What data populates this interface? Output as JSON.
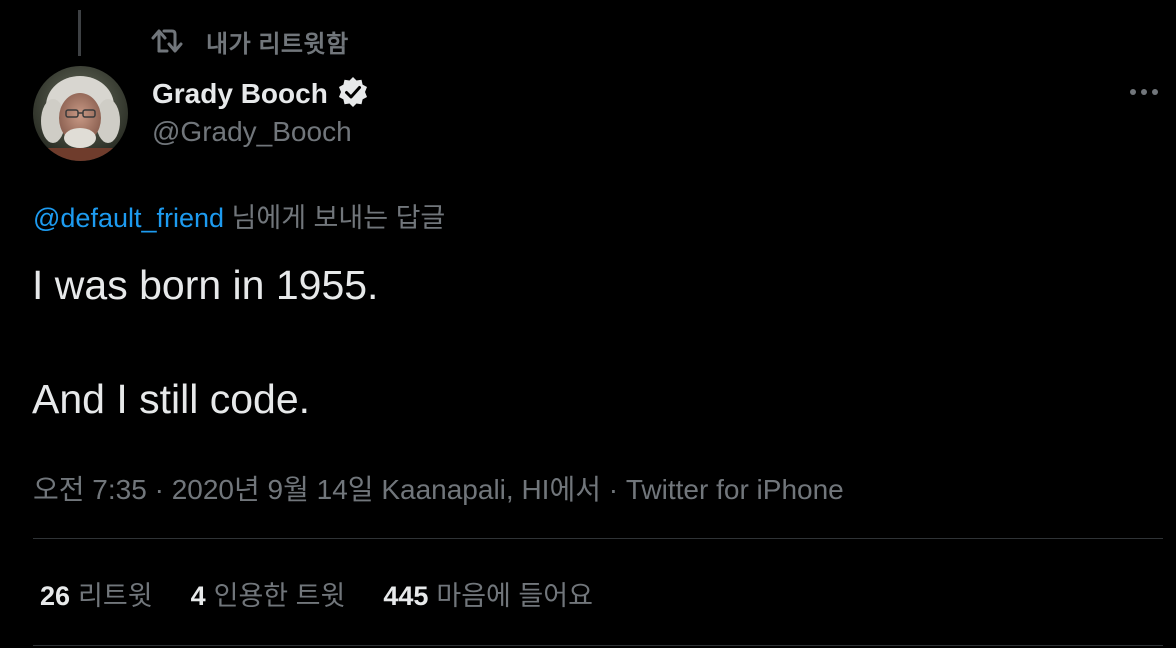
{
  "colors": {
    "background": "#000000",
    "primary_text": "#e7e9ea",
    "secondary_text": "#71767b",
    "link": "#1d9bf0",
    "divider": "#2f3336"
  },
  "social_context": {
    "icon": "retweet-icon",
    "label": "내가 리트윗함"
  },
  "author": {
    "name": "Grady Booch",
    "handle": "@Grady_Booch",
    "verified_icon": "verified-badge-icon",
    "avatar": "avatar-photo"
  },
  "more_menu_icon": "more-horizontal-icon",
  "reply_context": {
    "mention": "@default_friend",
    "suffix": " 님에게 보내는 답글"
  },
  "tweet": {
    "lines": [
      "I was born in 1955.",
      "And I still code."
    ]
  },
  "meta": {
    "time": "오전 7:35",
    "separator": " · ",
    "date": "2020년 9월 14일",
    "location": "Kaanapali, HI에서",
    "source": "Twitter for iPhone"
  },
  "stats": [
    {
      "count": "26",
      "label": "리트윗"
    },
    {
      "count": "4",
      "label": "인용한 트윗"
    },
    {
      "count": "445",
      "label": "마음에 들어요"
    }
  ]
}
